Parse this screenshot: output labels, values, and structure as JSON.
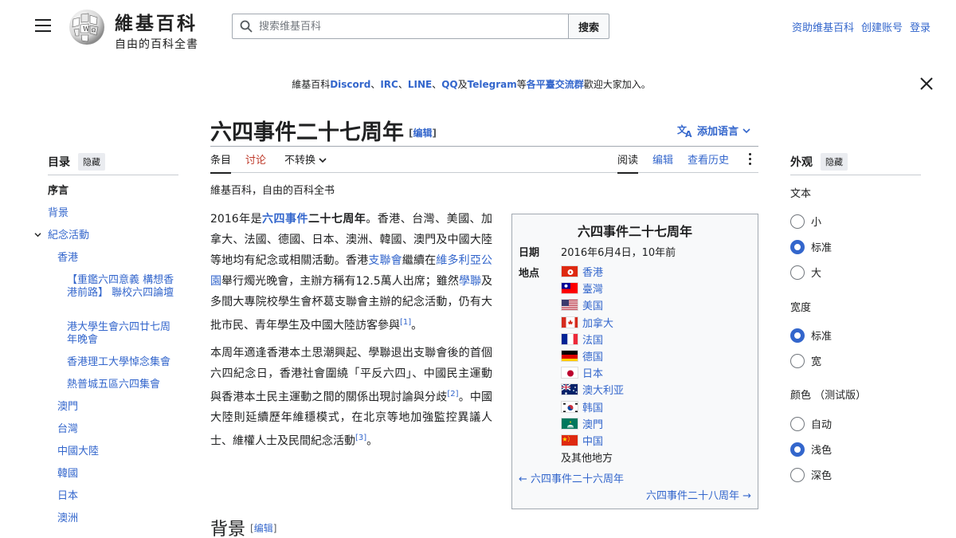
{
  "header": {
    "site_title": "維基百科",
    "site_tagline": "自由的百科全書",
    "search_placeholder": "搜索维基百科",
    "search_button": "搜索",
    "links": [
      "资助维基百科",
      "创建账号",
      "登录"
    ]
  },
  "notice": {
    "parts": [
      {
        "text": "維基百科",
        "link": false
      },
      {
        "text": "Discord",
        "link": true
      },
      {
        "text": "、",
        "link": false
      },
      {
        "text": "IRC",
        "link": true
      },
      {
        "text": "、",
        "link": false
      },
      {
        "text": "LINE",
        "link": true
      },
      {
        "text": "、",
        "link": false
      },
      {
        "text": "QQ",
        "link": true
      },
      {
        "text": "及",
        "link": false
      },
      {
        "text": "Telegram",
        "link": true
      },
      {
        "text": "等",
        "link": false
      },
      {
        "text": "各平臺交流群",
        "link": true
      },
      {
        "text": "歡迎大家加入。",
        "link": false
      }
    ]
  },
  "article": {
    "title": "六四事件二十七周年",
    "edit_label": "编辑",
    "add_language": "添加语言",
    "tabs": {
      "article": "条目",
      "talk": "讨论",
      "variant": "不转换",
      "read": "阅读",
      "edit": "编辑",
      "history": "查看历史"
    },
    "tagline": "維基百科，自由的百科全书",
    "p1": [
      {
        "t": "2016年是"
      },
      {
        "t": "六四事件",
        "link": true,
        "b": true
      },
      {
        "t": "二十七周年",
        "b": true
      },
      {
        "t": "。香港、台灣、美國、加拿大、法國、德國、日本、澳洲、韓國、澳門及中國大陸等地均有紀念或相關活動。香港"
      },
      {
        "t": "支聯會",
        "link": true
      },
      {
        "t": "繼續在"
      },
      {
        "t": "維多利亞公園",
        "link": true
      },
      {
        "t": "舉行燭光晚會，主辦方稱有12.5萬人出席；雖然"
      },
      {
        "t": "學聯",
        "link": true
      },
      {
        "t": "及多間大專院校學生會杯葛支聯會主辦的紀念活動，仍有大批市民、青年學生及中國大陸訪客參與"
      },
      {
        "t": "[1]",
        "sup": true
      },
      {
        "t": "。"
      }
    ],
    "p2": [
      {
        "t": "本周年適逢香港本土思潮興起、學聯退出支聯會後的首個六四紀念日，香港社會圍繞「平反六四」、中國民主運動與香港本土民主運動之間的關係出現討論與分歧"
      },
      {
        "t": "[2]",
        "sup": true
      },
      {
        "t": "。中國大陸則延續歷年維穩模式，在北京等地加強監控異議人士、維權人士及民間紀念活動"
      },
      {
        "t": "[3]",
        "sup": true
      },
      {
        "t": "。"
      }
    ],
    "section_heading": "背景"
  },
  "infobox": {
    "title": "六四事件二十七周年",
    "date_label": "日期",
    "date_value": "2016年6月4日，10年前",
    "place_label": "地点",
    "places": [
      {
        "name": "香港",
        "flag": "hk"
      },
      {
        "name": "臺灣",
        "flag": "tw"
      },
      {
        "name": "美国",
        "flag": "us"
      },
      {
        "name": "加拿大",
        "flag": "ca"
      },
      {
        "name": "法国",
        "flag": "fr"
      },
      {
        "name": "德国",
        "flag": "de"
      },
      {
        "name": "日本",
        "flag": "jp"
      },
      {
        "name": "澳大利亚",
        "flag": "au"
      },
      {
        "name": "韩国",
        "flag": "kr"
      },
      {
        "name": "澳門",
        "flag": "mo"
      },
      {
        "name": "中国",
        "flag": "cn"
      }
    ],
    "places_other": "及其他地方",
    "prev": "← 六四事件二十六周年",
    "next": "六四事件二十八周年 →"
  },
  "toc": {
    "title": "目录",
    "hide": "隐藏",
    "items": [
      {
        "label": "序言",
        "level": 0,
        "current": true
      },
      {
        "label": "背景",
        "level": 0
      },
      {
        "label": "紀念活動",
        "level": 0
      },
      {
        "label": "香港",
        "level": 1
      },
      {
        "label": "【重鑑六四意義 構想香港前路】 聯校六四論壇",
        "level": 2
      },
      {
        "label": "港大學生會六四廿七周年晚會",
        "level": 2
      },
      {
        "label": "香港理工大學悼念集會",
        "level": 2
      },
      {
        "label": "熱普城五區六四集會",
        "level": 2
      },
      {
        "label": "澳門",
        "level": 1
      },
      {
        "label": "台灣",
        "level": 1
      },
      {
        "label": "中國大陸",
        "level": 1
      },
      {
        "label": "韓國",
        "level": 1
      },
      {
        "label": "日本",
        "level": 1
      },
      {
        "label": "澳洲",
        "level": 1
      }
    ]
  },
  "appearance": {
    "title": "外观",
    "hide": "隐藏",
    "text_label": "文本",
    "text_options": [
      "小",
      "标准",
      "大"
    ],
    "text_selected": "标准",
    "width_label": "宽度",
    "width_options": [
      "标准",
      "宽"
    ],
    "width_selected": "标准",
    "color_label": "颜色 （测试版）",
    "color_options": [
      "自动",
      "浅色",
      "深色"
    ],
    "color_selected": "浅色"
  },
  "colors": {
    "link": "#3366cc",
    "talk_tab": "#bf3c2c",
    "text": "#202122",
    "infobox_bg": "#f8f9fa"
  }
}
